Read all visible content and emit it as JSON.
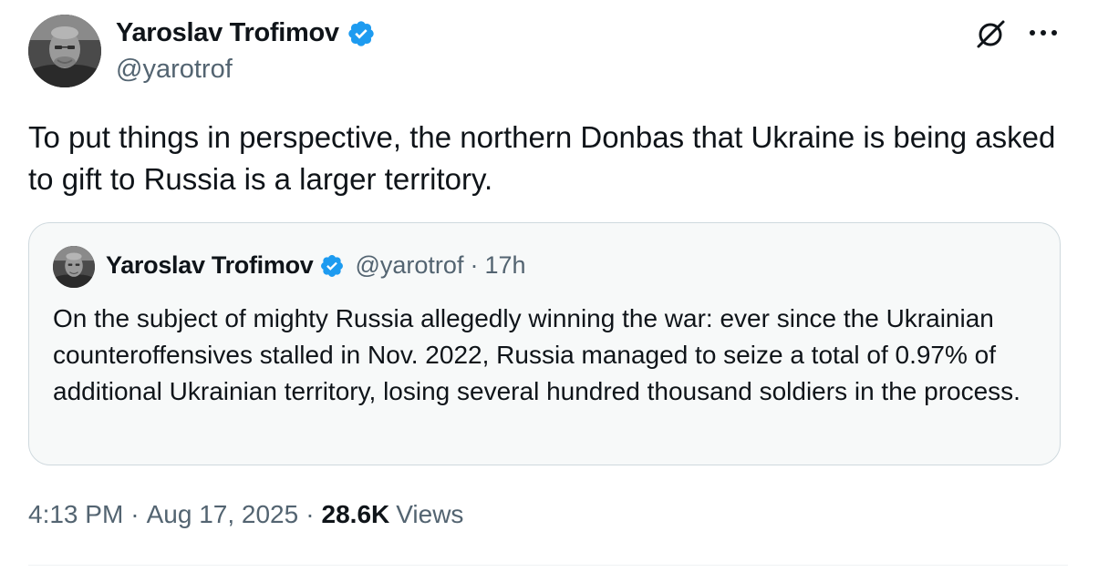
{
  "author": {
    "name": "Yaroslav Trofimov",
    "handle": "@yarotrof"
  },
  "tweet": {
    "text": "To put things in perspective, the northern Donbas that Ukraine is being asked to gift to Russia is a larger territory."
  },
  "quote": {
    "name": "Yaroslav Trofimov",
    "handle": "@yarotrof",
    "separator": "·",
    "time": "17h",
    "text": "On the subject of mighty Russia allegedly winning the war: ever since the Ukrainian counteroffensives stalled in Nov. 2022, Russia managed to seize a total of 0.97% of additional Ukrainian territory, losing several hundred thousand soldiers in the process."
  },
  "meta": {
    "time": "4:13 PM",
    "date": "Aug 17, 2025",
    "separator": "·",
    "views_count": "28.6K",
    "views_label": "Views"
  },
  "colors": {
    "verified_badge": "#1d9bf0",
    "secondary_text": "#536471",
    "primary_text": "#0f1419",
    "quote_border": "#cfd9de"
  },
  "icons": {
    "verified": "verified-badge-icon",
    "grok": "grok-icon",
    "more": "more-icon"
  }
}
